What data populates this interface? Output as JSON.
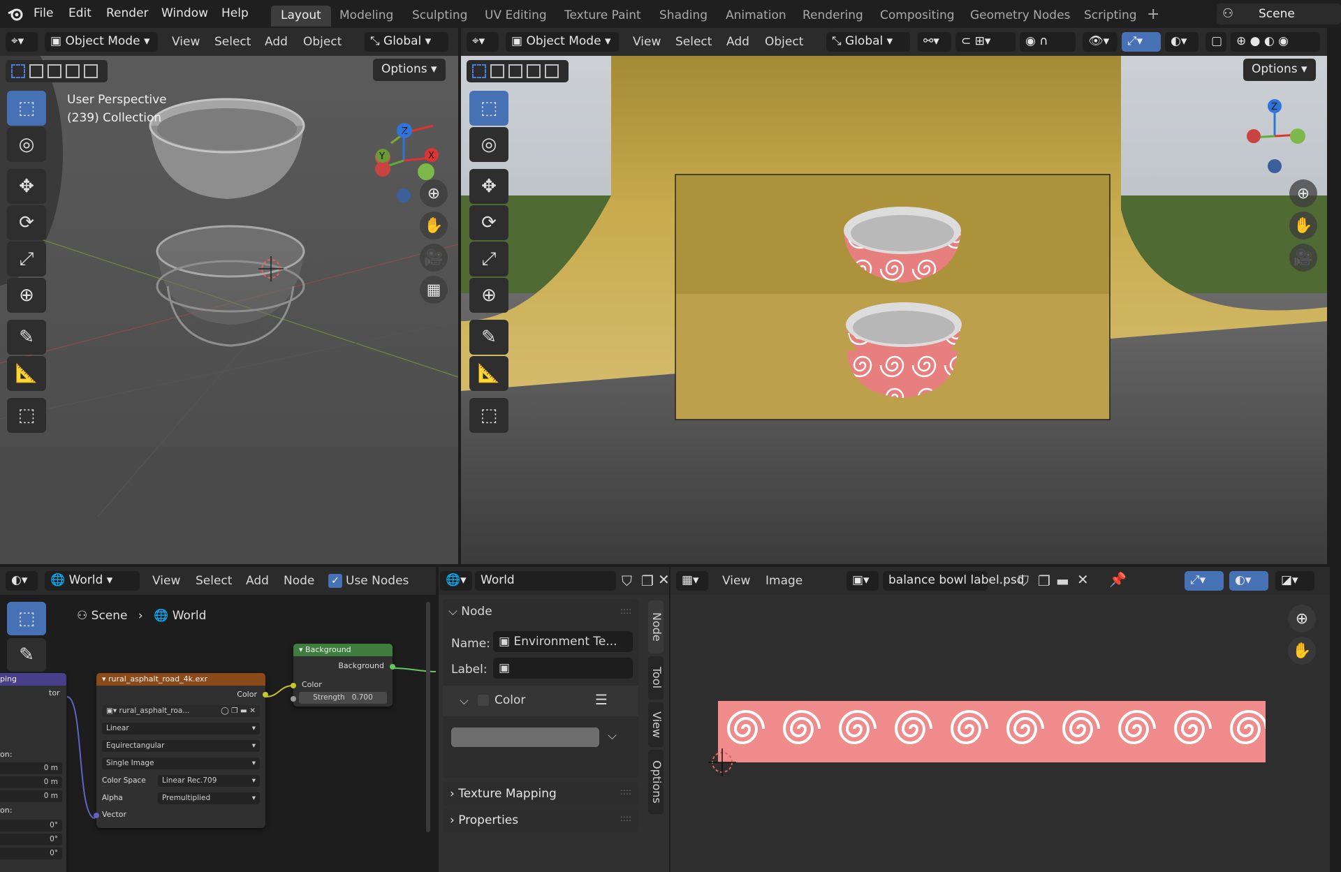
{
  "menu": [
    "File",
    "Edit",
    "Render",
    "Window",
    "Help"
  ],
  "workspaces": [
    "Layout",
    "Modeling",
    "Sculpting",
    "UV Editing",
    "Texture Paint",
    "Shading",
    "Animation",
    "Rendering",
    "Compositing",
    "Geometry Nodes",
    "Scripting"
  ],
  "scene_name": "Scene",
  "viewport_left": {
    "mode": "Object Mode",
    "menus": [
      "View",
      "Select",
      "Add",
      "Object"
    ],
    "transform": "Global",
    "options": "Options",
    "overlay_line1": "User Perspective",
    "overlay_line2": "(239) Collection",
    "gizmo": {
      "z": "Z",
      "y": "Y",
      "x": "X"
    }
  },
  "viewport_right": {
    "mode": "Object Mode",
    "menus": [
      "View",
      "Select",
      "Add",
      "Object"
    ],
    "transform": "Global",
    "options": "Options",
    "gizmo": {
      "z": "Z"
    }
  },
  "node_editor": {
    "world_label": "World",
    "menus": [
      "View",
      "Select",
      "Add",
      "Node"
    ],
    "use_nodes": "Use Nodes",
    "breadcrumb_scene": "Scene",
    "breadcrumb_world": "World",
    "left_node_partial": {
      "head": "ping",
      "socket": "tor",
      "loc_label": "on:",
      "loc": [
        "0 m",
        "0 m",
        "0 m"
      ],
      "rot_label": "on:",
      "rot": [
        "0°",
        "0°",
        "0°"
      ]
    },
    "image_node": {
      "title": "rural_asphalt_road_4k.exr",
      "color_out": "Color",
      "image_name": "rural_asphalt_roa...",
      "interpolation": "Linear",
      "projection": "Equirectangular",
      "source": "Single Image",
      "color_space_label": "Color Space",
      "color_space": "Linear Rec.709",
      "alpha_label": "Alpha",
      "alpha": "Premultiplied",
      "vector_in": "Vector"
    },
    "bg_node": {
      "title": "Background",
      "out": "Background",
      "color_in": "Color",
      "strength_label": "Strength",
      "strength": "0.700"
    }
  },
  "properties_panel": {
    "world_label": "World",
    "node_section": "Node",
    "name_label": "Name:",
    "name_value": "Environment Te...",
    "label_label": "Label:",
    "label_value": "",
    "color_section": "Color",
    "texture_mapping": "Texture Mapping",
    "properties": "Properties",
    "tabs": [
      "Node",
      "Tool",
      "View",
      "Options"
    ]
  },
  "image_editor": {
    "menus": [
      "View",
      "Image"
    ],
    "image_name": "balance bowl label.psd"
  },
  "colors": {
    "accent": "#4672b5",
    "bg_node_header": "#3f7d3f",
    "image_node_header": "#8a4a1a",
    "label_pink": "#f08b8b",
    "backdrop_yellow": "#c6a84a"
  }
}
